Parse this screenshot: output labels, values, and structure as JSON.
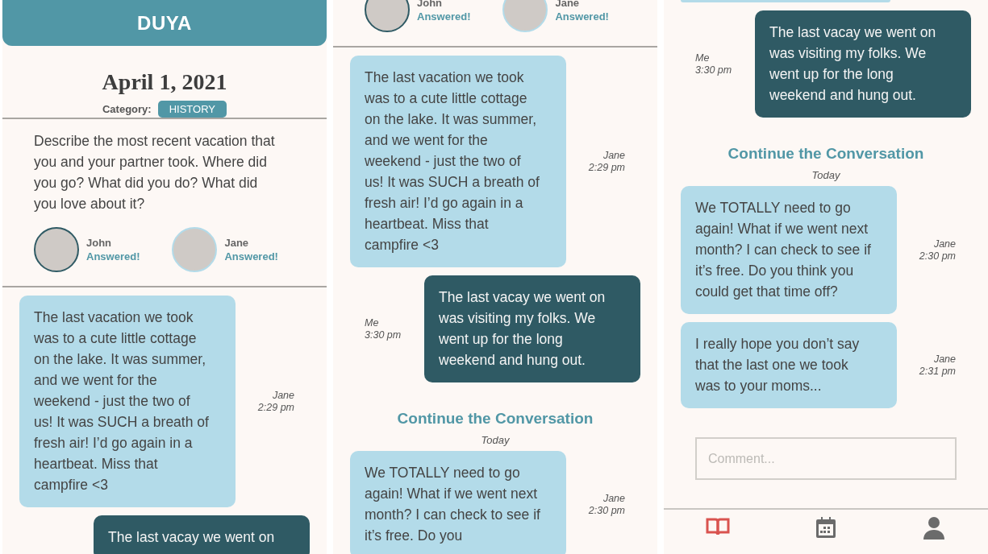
{
  "screens": [
    {
      "items": [
        {
          "kind": "app_header",
          "title": "DUYA"
        },
        {
          "kind": "date",
          "text": "April 1, 2021"
        },
        {
          "kind": "category",
          "label": "Category:",
          "value": "HISTORY"
        },
        {
          "kind": "divider"
        },
        {
          "kind": "prompt",
          "text": "Describe the most recent vacation that you and your partner took. Where did you go? What did you do? What did you love about it?"
        },
        {
          "kind": "participants",
          "people": [
            {
              "name": "John",
              "status": "Answered!",
              "color": "#2f5a64"
            },
            {
              "name": "Jane",
              "status": "Answered!",
              "color": "#b3dbe9"
            }
          ]
        },
        {
          "kind": "divider"
        },
        {
          "kind": "incoming_message",
          "text": "The last vacation we took was to a cute little cottage on the lake. It was summer, and we went for the weekend - just the two of us! It was SUCH a breath of fresh air! I’d go again in a heartbeat. Miss that campfire <3",
          "author": "Jane",
          "time": "2:29 pm"
        },
        {
          "kind": "outgoing_message",
          "text": "The last vacay we went on"
        }
      ]
    },
    {
      "items": [
        {
          "kind": "participants",
          "people": [
            {
              "name": "John",
              "status": "Answered!",
              "color": "#2f5a64"
            },
            {
              "name": "Jane",
              "status": "Answered!",
              "color": "#b3dbe9"
            }
          ]
        },
        {
          "kind": "divider"
        },
        {
          "kind": "incoming_message",
          "text": "The last vacation we took was to a cute little cottage on the lake. It was summer, and we went for the weekend - just the two of us! It was SUCH a breath of fresh air! I’d go again in a heartbeat. Miss that campfire <3",
          "author": "Jane",
          "time": "2:29 pm"
        },
        {
          "kind": "outgoing_message",
          "text": "The last vacay we went on was visiting my folks. We went up for the long weekend and hung out.",
          "author": "Me",
          "time": "3:30 pm"
        },
        {
          "kind": "section_title",
          "text": "Continue the Conversation"
        },
        {
          "kind": "day_label",
          "text": "Today"
        },
        {
          "kind": "incoming_message",
          "text": "We TOTALLY need to go again! What if we went next month? I can check to see if it’s free. Do you",
          "author": "Jane",
          "time": "2:30 pm"
        }
      ]
    },
    {
      "items": [
        {
          "kind": "message_edge"
        },
        {
          "kind": "outgoing_message",
          "text": "The last vacay we went on was visiting my folks. We went up for the long weekend and hung out.",
          "author": "Me",
          "time": "3:30 pm"
        },
        {
          "kind": "section_title",
          "text": "Continue the Conversation"
        },
        {
          "kind": "day_label",
          "text": "Today"
        },
        {
          "kind": "incoming_message",
          "text": "We TOTALLY need to go again! What if we went next month? I can check to see if it’s free. Do you think you could get that time off?",
          "author": "Jane",
          "time": "2:30 pm"
        },
        {
          "kind": "incoming_message",
          "text": "I really hope you don’t say that the last one we took was to your moms...",
          "author": "Jane",
          "time": "2:31 pm"
        },
        {
          "kind": "comment",
          "placeholder": "Comment..."
        },
        {
          "kind": "nav",
          "items": [
            {
              "selected": true
            },
            {
              "selected": false
            },
            {
              "selected": false
            }
          ]
        }
      ]
    }
  ]
}
